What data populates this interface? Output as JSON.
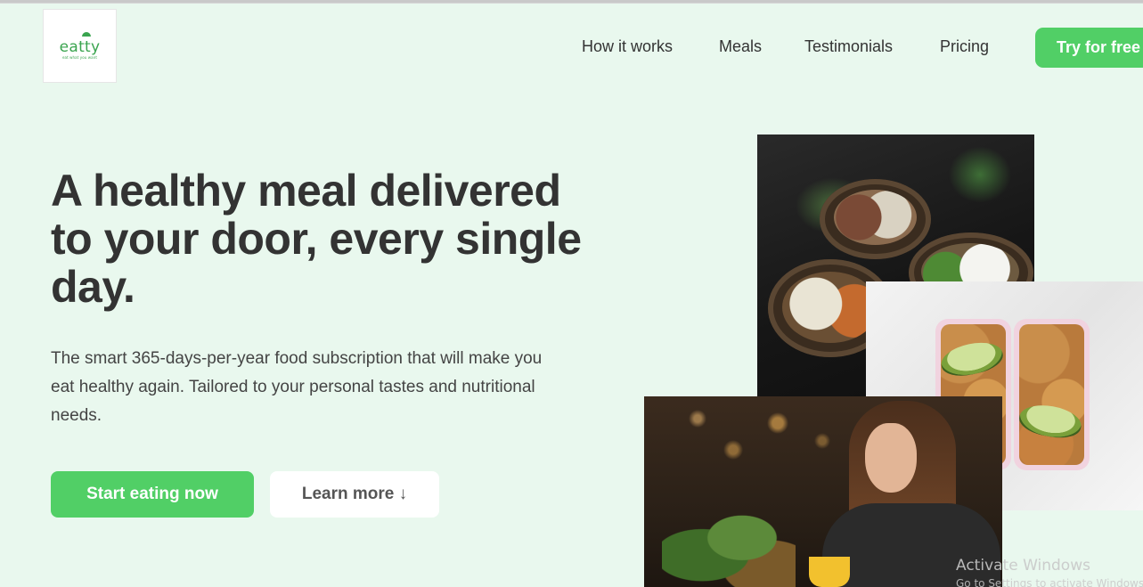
{
  "header": {
    "logo": {
      "name": "eatty",
      "tagline": "eat what you want"
    },
    "nav": [
      "How it works",
      "Meals",
      "Testimonials",
      "Pricing"
    ],
    "cta_label": "Try for free"
  },
  "hero": {
    "title": "A healthy meal delivered to your door, every single day.",
    "description": "The smart 365-days-per-year food subscription that will make you eat healthy again. Tailored to your personal tastes and nutritional needs.",
    "primary_button": "Start eating now",
    "secondary_button": "Learn more ↓"
  },
  "watermark": {
    "title": "Activate Windows",
    "subtitle": "Go to Settings to activate Windows."
  },
  "colors": {
    "background": "#e9f8ee",
    "accent": "#51cf66",
    "text": "#333333"
  }
}
